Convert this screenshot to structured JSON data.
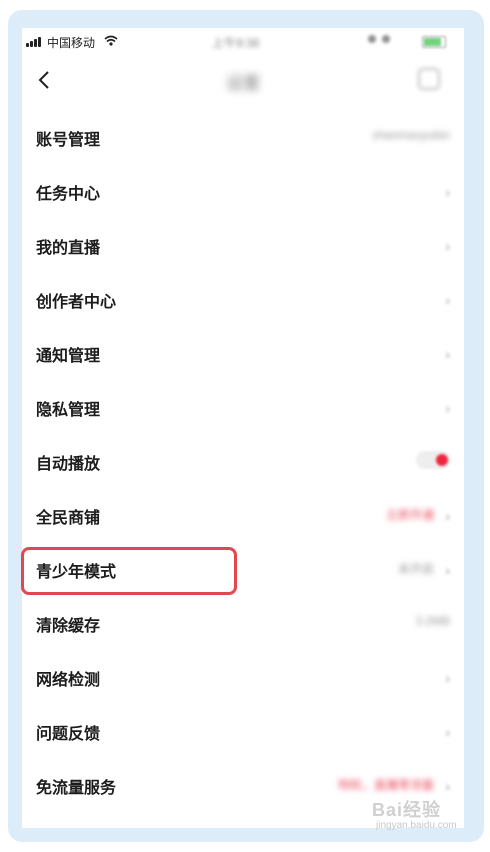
{
  "status_bar": {
    "carrier": "中国移动",
    "time": "上午9:38"
  },
  "header": {
    "title": "设置"
  },
  "settings": [
    {
      "label": "账号管理",
      "value": "zhanmaoyubin",
      "accessory": "none"
    },
    {
      "label": "任务中心",
      "value": "",
      "accessory": "chevron"
    },
    {
      "label": "我的直播",
      "value": "",
      "accessory": "chevron"
    },
    {
      "label": "创作者中心",
      "value": "",
      "accessory": "chevron"
    },
    {
      "label": "通知管理",
      "value": "",
      "accessory": "chevron"
    },
    {
      "label": "隐私管理",
      "value": "",
      "accessory": "chevron"
    },
    {
      "label": "自动播放",
      "value": "",
      "accessory": "toggle",
      "toggle_on": true
    },
    {
      "label": "全民商铺",
      "value": "立即开通",
      "accessory": "chevron",
      "value_color": "#e84a5f"
    },
    {
      "label": "青少年模式",
      "value": "未开启",
      "accessory": "chevron",
      "highlighted": true
    },
    {
      "label": "清除缓存",
      "value": "3.2MB",
      "accessory": "none"
    },
    {
      "label": "网络检测",
      "value": "",
      "accessory": "chevron"
    },
    {
      "label": "问题反馈",
      "value": "",
      "accessory": "chevron"
    },
    {
      "label": "免流量服务",
      "value": "特权，直播零流量",
      "accessory": "chevron",
      "value_color": "#e84a5f"
    }
  ],
  "chevron_glyph": "›",
  "colors": {
    "frame_background": "#dcedf9",
    "highlight_border": "#e2474f",
    "accent_red": "#f0263e"
  },
  "watermark": {
    "text": "Bai经验",
    "sub": "jingyan.baidu.com"
  }
}
